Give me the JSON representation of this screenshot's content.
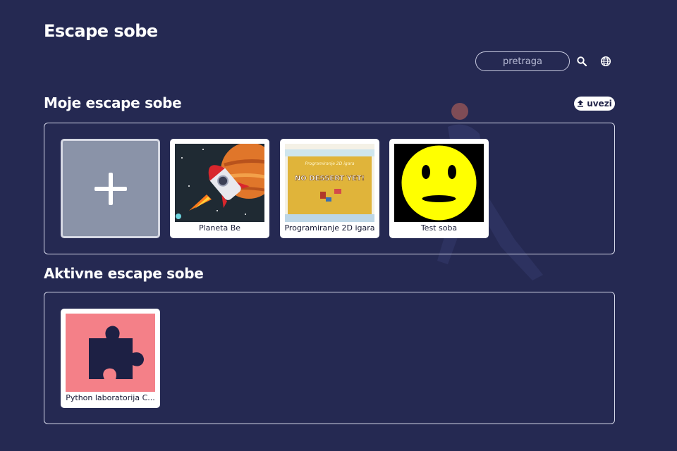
{
  "header": {
    "title": "Escape sobe",
    "search_placeholder": "pretraga",
    "search_icon": "search-icon",
    "language_icon": "globe-icon"
  },
  "my_rooms": {
    "title": "Moje escape sobe",
    "import_label": "uvezi",
    "import_icon": "upload-icon",
    "add_icon": "plus-icon",
    "cards": [
      {
        "label": "Planeta Be",
        "thumb": "rocket-planet"
      },
      {
        "label": "Programiranje 2D igara",
        "thumb": "no-dessert-game",
        "thumb_title": "Programiranje 2D igara",
        "thumb_text": "NO DESSERT YET!"
      },
      {
        "label": "Test soba",
        "thumb": "neutral-face"
      }
    ]
  },
  "active_rooms": {
    "title": "Aktivne escape sobe",
    "cards": [
      {
        "label": "Python laboratorija C...",
        "thumb": "puzzle-piece"
      }
    ]
  },
  "colors": {
    "background": "#252952",
    "accent_pink": "#f48088",
    "puzzle_dark": "#1d2044"
  }
}
